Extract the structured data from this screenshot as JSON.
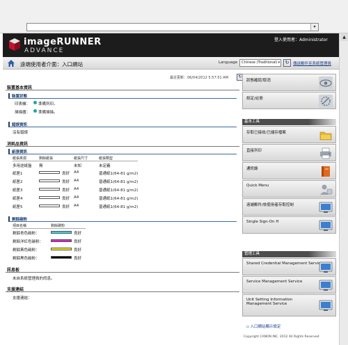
{
  "colors": {
    "header_bg": "#1c1c1c",
    "accent_blue": "#1c3e70",
    "status_teal": "#1aa8a0",
    "canon_red": "#c8102e"
  },
  "header": {
    "brand_line1": "imageRUNNER",
    "brand_line2": "ADVANCE",
    "user_label": "登入使用者：Administrator",
    "language_label": "Language",
    "logo_icon": "canon-cube-icon"
  },
  "titlebar": {
    "title": "遠端使用者介面：入口網站",
    "language_value": "Chinese (Traditional)",
    "mail_link": "傳送郵件至系統管理員",
    "home_icon": "home-icon"
  },
  "main": {
    "last_updated": "最近更新：06/04/2012 5:57:51 AM",
    "device_basic_info": "裝置基本資訊",
    "device_status": {
      "heading": "裝置狀態",
      "rows": [
        {
          "label": "印表機：",
          "status": "準備列印。"
        },
        {
          "label": "掃描器：",
          "status": "準備掃描。"
        }
      ]
    },
    "error_info": {
      "heading": "錯誤資訊",
      "text": "沒有錯誤"
    },
    "consumables": {
      "heading": "消耗品資訊",
      "paper": {
        "heading": "紙張資訊",
        "columns": [
          "紙張來源",
          "剩餘紙張",
          "紙張尺寸",
          "紙張類型"
        ],
        "rows": [
          {
            "source": "多用途紙盤",
            "remaining": "無",
            "size": "未知",
            "type": "未定義",
            "bar": false
          },
          {
            "source": "紙匣1",
            "remaining": "良好",
            "size": "A4",
            "type": "普通紙1(64-81 g/m2)",
            "bar": true
          },
          {
            "source": "紙匣2",
            "remaining": "良好",
            "size": "A4",
            "type": "普通紙1(64-81 g/m2)",
            "bar": true
          },
          {
            "source": "紙匣3",
            "remaining": "良好",
            "size": "A4",
            "type": "普通紙1(64-81 g/m2)",
            "bar": true
          },
          {
            "source": "紙匣4",
            "remaining": "良好",
            "size": "A4",
            "type": "普通紙1(64-81 g/m2)",
            "bar": true
          },
          {
            "source": "紙匣5",
            "remaining": "良好",
            "size": "A4",
            "type": "普通紙1(64-81 g/m2)",
            "bar": true
          }
        ]
      },
      "toner": {
        "heading": "剩餘碳粉",
        "columns": [
          "項目名稱",
          "剩餘碳粉"
        ],
        "rows": [
          {
            "name": "剩餘青色碳粉：",
            "level": "良好",
            "color": "#33d6e6"
          },
          {
            "name": "剩餘洋紅色碳粉：",
            "level": "良好",
            "color": "#e020c8"
          },
          {
            "name": "剩餘黃色碳粉：",
            "level": "良好",
            "color": "#f2ea1a"
          },
          {
            "name": "剩餘黑色碳粉：",
            "level": "良好",
            "color": "#0a0a0a"
          }
        ]
      }
    },
    "message_board": {
      "heading": "訊息板",
      "text": "未自系統管理員的訊息。"
    },
    "support_link": {
      "heading": "支援連結",
      "text": "支援連結："
    }
  },
  "sidebar": {
    "top_buttons": [
      {
        "label": "狀態確認/取消",
        "icon": "eye-icon"
      },
      {
        "label": "設定/註冊",
        "icon": "wrench-gear-icon"
      }
    ],
    "basic_tools": {
      "heading": "基本工具",
      "items": [
        {
          "label": "存取已接收/已儲存檔案",
          "icon": "folder-icon"
        },
        {
          "label": "直接列印",
          "icon": "printer-icon"
        },
        {
          "label": "通訊錄",
          "icon": "address-book-icon"
        },
        {
          "label": "Quick Menu",
          "icon": "quick-menu-icon"
        },
        {
          "label": "遠端郵件/依使用者存取控制",
          "icon": "monitor-icon"
        },
        {
          "label": "Single Sign-On H",
          "icon": "monitor-icon"
        }
      ]
    },
    "management_tools": {
      "heading": "管理工具",
      "items": [
        {
          "label": "Shared Credential Management Service",
          "icon": "monitor-icon"
        },
        {
          "label": "Service Management Service",
          "icon": "monitor-icon"
        },
        {
          "label": "Unit Setting Information Management Service",
          "icon": "monitor-icon"
        }
      ]
    },
    "entry_settings": "入口網站顯示設定"
  },
  "footer": {
    "copyright": "Copyright CANON INC. 2012 All Rights Reserved"
  }
}
